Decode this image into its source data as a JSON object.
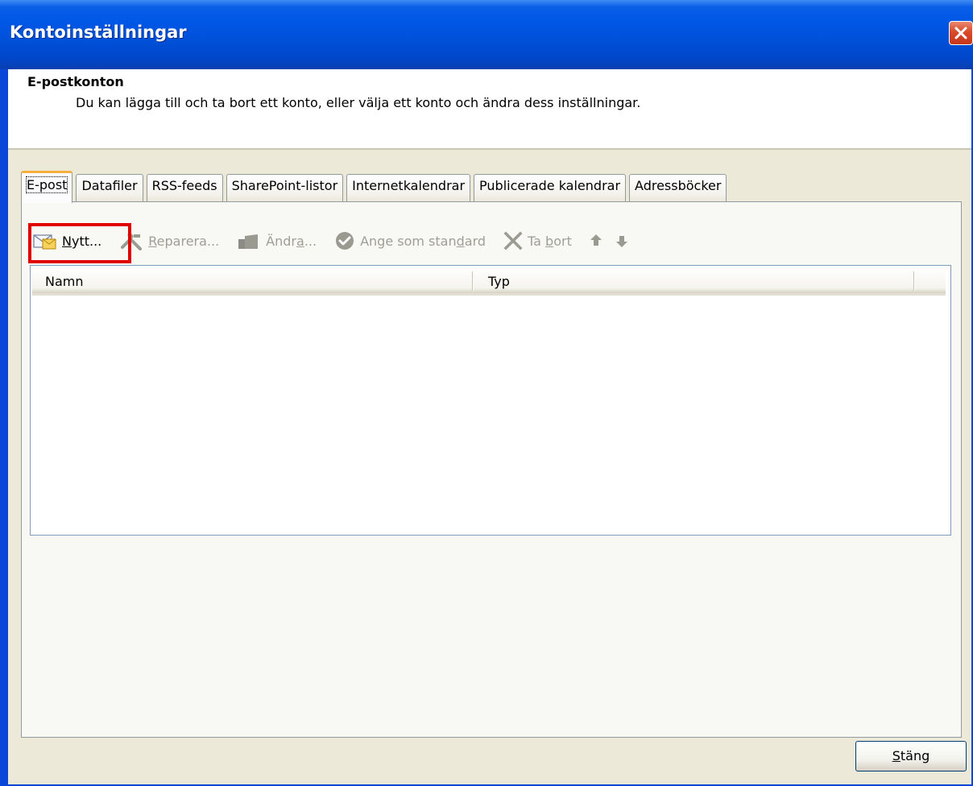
{
  "window": {
    "title": "Kontoinställningar"
  },
  "header": {
    "title": "E-postkonton",
    "description": "Du kan lägga till och ta bort ett konto, eller välja ett konto och ändra dess inställningar."
  },
  "tabs": [
    {
      "label": "E-post",
      "active": true
    },
    {
      "label": "Datafiler"
    },
    {
      "label": "RSS-feeds"
    },
    {
      "label": "SharePoint-listor"
    },
    {
      "label": "Internetkalendrar"
    },
    {
      "label": "Publicerade kalendrar"
    },
    {
      "label": "Adressböcker"
    }
  ],
  "toolbar": {
    "new": {
      "accel": "N",
      "rest": "ytt...",
      "enabled": true,
      "icon": "new-mail-icon"
    },
    "repair": {
      "accel": "R",
      "rest": "eparera...",
      "enabled": false,
      "icon": "tools-icon"
    },
    "change": {
      "pre": "Ändr",
      "accel": "a",
      "rest": "...",
      "enabled": false,
      "icon": "change-icon"
    },
    "default": {
      "pre": "Ange som stan",
      "accel": "d",
      "rest": "ard",
      "enabled": false,
      "icon": "check-circle-icon"
    },
    "remove": {
      "pre": "Ta ",
      "accel": "b",
      "rest": "ort",
      "enabled": false,
      "icon": "x-icon"
    },
    "up": {
      "icon": "arrow-up-icon",
      "enabled": false
    },
    "down": {
      "icon": "arrow-down-icon",
      "enabled": false
    }
  },
  "list": {
    "columns": [
      "Namn",
      "Typ"
    ],
    "rows": []
  },
  "footer": {
    "close": {
      "accel": "S",
      "rest": "täng"
    }
  },
  "colors": {
    "titlebar": "#0058e6",
    "highlight": "#e00000",
    "tab_active_accent": "#f7ae3a",
    "window_bg": "#ece9d8"
  }
}
